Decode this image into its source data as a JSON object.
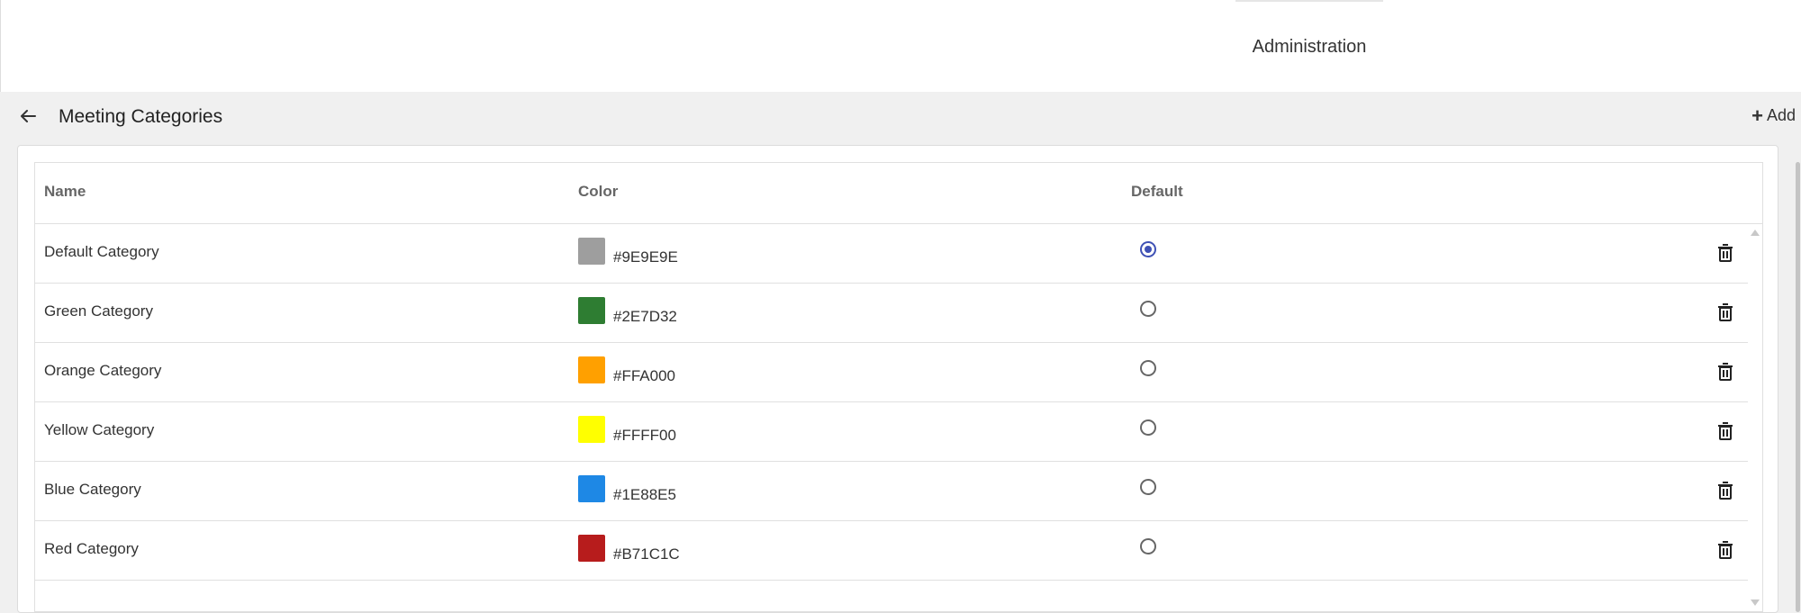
{
  "topbar": {
    "active_tab": "Administration"
  },
  "header": {
    "title": "Meeting Categories",
    "add_label": "Add"
  },
  "table": {
    "columns": [
      "Name",
      "Color",
      "Default"
    ],
    "rows": [
      {
        "name": "Default Category",
        "color": "#9E9E9E",
        "hex": "#9E9E9E",
        "is_default": true
      },
      {
        "name": "Green Category",
        "color": "#2E7D32",
        "hex": "#2E7D32",
        "is_default": false
      },
      {
        "name": "Orange Category",
        "color": "#FFA000",
        "hex": "#FFA000",
        "is_default": false
      },
      {
        "name": "Yellow Category",
        "color": "#FFFF00",
        "hex": "#FFFF00",
        "is_default": false
      },
      {
        "name": "Blue Category",
        "color": "#1E88E5",
        "hex": "#1E88E5",
        "is_default": false
      },
      {
        "name": "Red Category",
        "color": "#B71C1C",
        "hex": "#B71C1C",
        "is_default": false
      }
    ]
  },
  "icons": {
    "back": "arrow-left-icon",
    "add": "plus-icon",
    "delete": "trash-icon"
  },
  "colors": {
    "accent": "#3f51b5"
  }
}
